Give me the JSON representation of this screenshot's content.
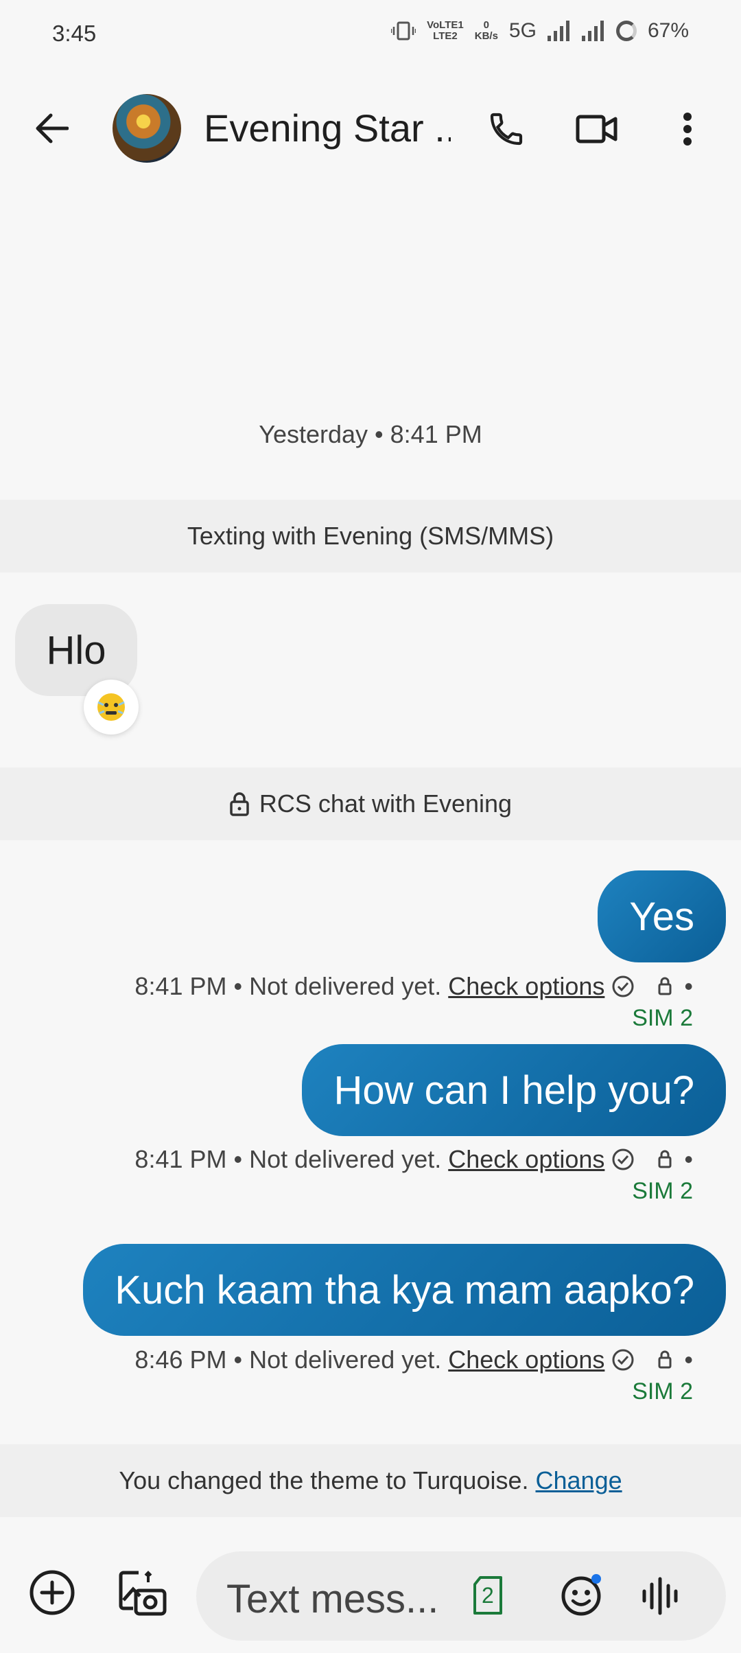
{
  "status_bar": {
    "time": "3:45",
    "net_speed_top": "0",
    "net_speed_unit": "KB/s",
    "volte_top": "VoLTE1",
    "volte_bottom": "LTE2",
    "network": "5G",
    "battery": "67%"
  },
  "header": {
    "contact_name": "Evening Star ...",
    "icons": [
      "back-arrow-icon",
      "phone-icon",
      "video-call-icon",
      "more-vert-icon"
    ]
  },
  "conversation": {
    "day_stamp": "Yesterday • 8:41 PM",
    "sms_band": "Texting with Evening (SMS/MMS)",
    "incoming": {
      "text": "Hlo",
      "reaction": "cold-face-emoji"
    },
    "rcs_band": "RCS chat with Evening",
    "outgoing": [
      {
        "text": "Yes",
        "time": "8:41 PM",
        "status": "• Not delivered yet.",
        "action": "Check options",
        "sim": "SIM 2"
      },
      {
        "text": "How can I help you?",
        "time": "8:41 PM",
        "status": "• Not delivered yet.",
        "action": "Check options",
        "sim": "SIM 2"
      },
      {
        "text": "Kuch kaam tha kya mam aapko?",
        "time": "8:46 PM",
        "status": "• Not delivered yet.",
        "action": "Check options",
        "sim": "SIM 2"
      }
    ],
    "theme_band": {
      "text": "You changed the theme to Turquoise.",
      "link": "Change"
    }
  },
  "compose": {
    "placeholder": "Text mess...",
    "sim_badge": "2"
  },
  "colors": {
    "bubble_gradient_start": "#1e82bf",
    "bubble_gradient_end": "#0b5f97",
    "sim_green": "#1b7a3a"
  }
}
